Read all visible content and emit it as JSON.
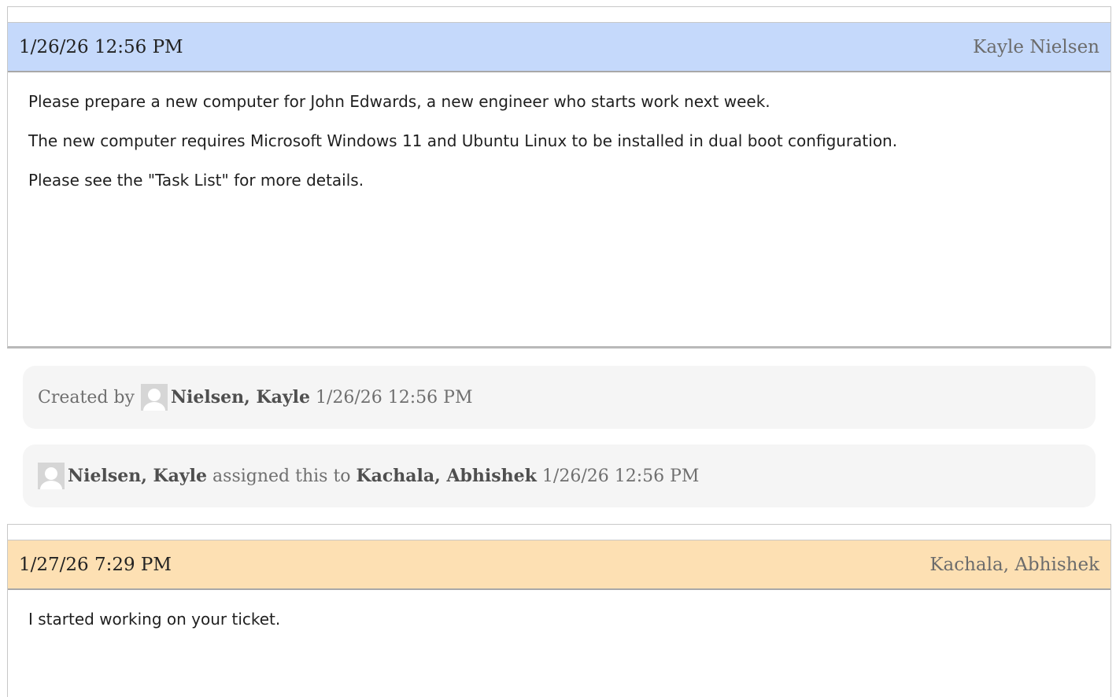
{
  "colors": {
    "ticket_header_bg": "#c5d9fb",
    "reply_header_bg": "#fde0b3",
    "event_bg": "#f5f5f5"
  },
  "ticket": {
    "date": "1/26/26 12:56 PM",
    "author": "Kayle Nielsen",
    "paragraphs": [
      "Please prepare a new computer for John Edwards, a new engineer who starts work next week.",
      "The new computer requires Microsoft Windows 11 and Ubuntu Linux to be installed in dual boot configuration.",
      "Please see the \"Task List\" for more details."
    ]
  },
  "events": {
    "created": {
      "prefix": "Created by",
      "user": "Nielsen, Kayle",
      "timestamp": "1/26/26 12:56 PM",
      "avatar_icon": "user-avatar-icon"
    },
    "assigned": {
      "user": "Nielsen, Kayle",
      "action": "assigned this to",
      "assignee": "Kachala, Abhishek",
      "timestamp": "1/26/26 12:56 PM",
      "avatar_icon": "user-avatar-icon"
    }
  },
  "reply": {
    "date": "1/27/26 7:29 PM",
    "author": "Kachala, Abhishek",
    "paragraphs": [
      "I started working on your ticket."
    ]
  }
}
